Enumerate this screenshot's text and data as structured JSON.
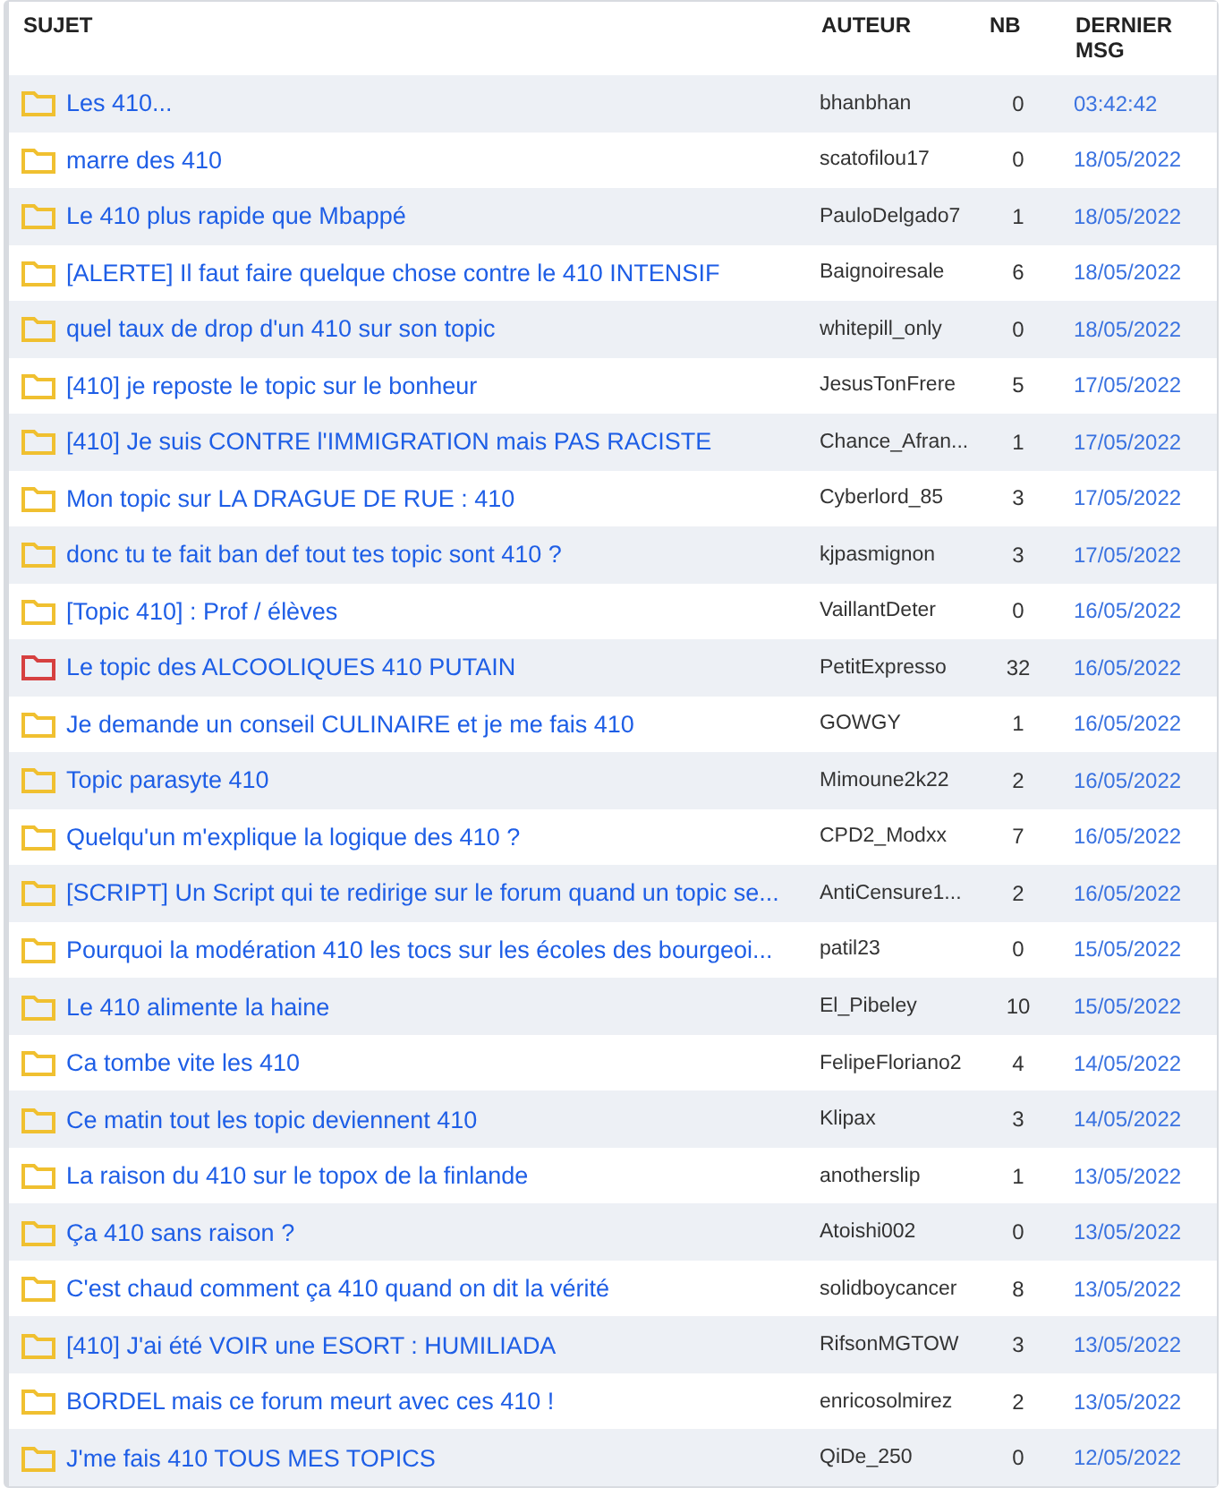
{
  "table": {
    "columns": [
      "SUJET",
      "AUTEUR",
      "NB",
      "DERNIER MSG"
    ],
    "rows": [
      {
        "subject": "Les 410...",
        "hot": false,
        "author": "bhanbhan",
        "nb": "0",
        "last": "03:42:42"
      },
      {
        "subject": "marre des 410",
        "hot": false,
        "author": "scatofilou17",
        "nb": "0",
        "last": "18/05/2022"
      },
      {
        "subject": "Le 410 plus rapide que Mbappé",
        "hot": false,
        "author": "PauloDelgado7",
        "nb": "1",
        "last": "18/05/2022"
      },
      {
        "subject": "[ALERTE] Il faut faire quelque chose contre le 410 INTENSIF",
        "hot": false,
        "author": "Baignoiresale",
        "nb": "6",
        "last": "18/05/2022"
      },
      {
        "subject": "quel taux de drop d'un 410 sur son topic",
        "hot": false,
        "author": "whitepill_only",
        "nb": "0",
        "last": "18/05/2022"
      },
      {
        "subject": "[410] je reposte le topic sur le bonheur",
        "hot": false,
        "author": "JesusTonFrere",
        "nb": "5",
        "last": "17/05/2022"
      },
      {
        "subject": "[410] Je suis CONTRE l'IMMIGRATION mais PAS RACISTE",
        "hot": false,
        "author": "Chance_Afran...",
        "nb": "1",
        "last": "17/05/2022"
      },
      {
        "subject": "Mon topic sur LA DRAGUE DE RUE : 410",
        "hot": false,
        "author": "Cyberlord_85",
        "nb": "3",
        "last": "17/05/2022"
      },
      {
        "subject": "donc tu te fait ban def tout tes topic sont 410 ?",
        "hot": false,
        "author": "kjpasmignon",
        "nb": "3",
        "last": "17/05/2022"
      },
      {
        "subject": "[Topic 410] : Prof / élèves",
        "hot": false,
        "author": "VaillantDeter",
        "nb": "0",
        "last": "16/05/2022"
      },
      {
        "subject": "Le topic des ALCOOLIQUES 410 PUTAIN",
        "hot": true,
        "author": "PetitExpresso",
        "nb": "32",
        "last": "16/05/2022"
      },
      {
        "subject": "Je demande un conseil CULINAIRE et je me fais 410",
        "hot": false,
        "author": "GOWGY",
        "nb": "1",
        "last": "16/05/2022"
      },
      {
        "subject": "Topic parasyte 410",
        "hot": false,
        "author": "Mimoune2k22",
        "nb": "2",
        "last": "16/05/2022"
      },
      {
        "subject": "Quelqu'un m'explique la logique des 410 ?",
        "hot": false,
        "author": "CPD2_Modxx",
        "nb": "7",
        "last": "16/05/2022"
      },
      {
        "subject": "[SCRIPT] Un Script qui te redirige sur le forum quand un topic se...",
        "hot": false,
        "author": "AntiCensure1...",
        "nb": "2",
        "last": "16/05/2022"
      },
      {
        "subject": "Pourquoi la modération 410 les tocs sur les écoles des bourgeoi...",
        "hot": false,
        "author": "patil23",
        "nb": "0",
        "last": "15/05/2022"
      },
      {
        "subject": "Le 410 alimente la haine",
        "hot": false,
        "author": "El_Pibeley",
        "nb": "10",
        "last": "15/05/2022"
      },
      {
        "subject": "Ca tombe vite les 410",
        "hot": false,
        "author": "FelipeFloriano2",
        "nb": "4",
        "last": "14/05/2022"
      },
      {
        "subject": "Ce matin tout les topic deviennent 410",
        "hot": false,
        "author": "Klipax",
        "nb": "3",
        "last": "14/05/2022"
      },
      {
        "subject": "La raison du 410 sur le topox de la finlande",
        "hot": false,
        "author": "anotherslip",
        "nb": "1",
        "last": "13/05/2022"
      },
      {
        "subject": "Ça 410 sans raison ?",
        "hot": false,
        "author": "Atoishi002",
        "nb": "0",
        "last": "13/05/2022"
      },
      {
        "subject": "C'est chaud comment ça 410 quand on dit la vérité",
        "hot": false,
        "author": "solidboycancer",
        "nb": "8",
        "last": "13/05/2022"
      },
      {
        "subject": "[410] J'ai été VOIR une ESORT : HUMILIADA",
        "hot": false,
        "author": "RifsonMGTOW",
        "nb": "3",
        "last": "13/05/2022"
      },
      {
        "subject": "BORDEL mais ce forum meurt avec ces 410 !",
        "hot": false,
        "author": "enricosolmirez",
        "nb": "2",
        "last": "13/05/2022"
      },
      {
        "subject": "J'me fais 410 TOUS MES TOPICS",
        "hot": false,
        "author": "QiDe_250",
        "nb": "0",
        "last": "12/05/2022"
      }
    ]
  }
}
